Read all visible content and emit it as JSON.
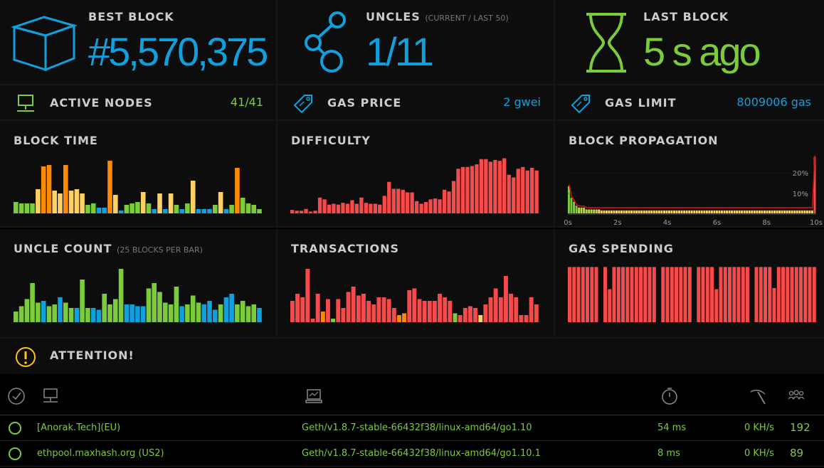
{
  "stats": {
    "best_block": {
      "label": "BEST BLOCK",
      "value": "#5,570,375",
      "icon": "cube-icon",
      "color": "#10a0de"
    },
    "uncles": {
      "label": "UNCLES",
      "sublabel": "(CURRENT / LAST 50)",
      "value": "1/11",
      "icon": "uncles-icon",
      "color": "#10a0de"
    },
    "last_block": {
      "label": "LAST BLOCK",
      "value": "5 s ago",
      "icon": "hourglass-icon",
      "color": "#7bcc3a"
    }
  },
  "mid": {
    "active_nodes": {
      "label": "ACTIVE NODES",
      "value": "41/41",
      "icon": "node-icon"
    },
    "gas_price": {
      "label": "GAS PRICE",
      "value": "2 gwei",
      "icon": "price-tag-icon"
    },
    "gas_limit": {
      "label": "GAS LIMIT",
      "value": "8009006 gas",
      "icon": "price-tag-icon"
    }
  },
  "colors": {
    "green": "#7bcc3a",
    "blue": "#10a0de",
    "orange": "#ff8a00",
    "yellow": "#ffd162",
    "red": "#f74b4b"
  },
  "charts": {
    "block_time": {
      "title": "BLOCK TIME"
    },
    "difficulty": {
      "title": "DIFFICULTY"
    },
    "block_propagation": {
      "title": "BLOCK PROPAGATION"
    },
    "uncle_count": {
      "title": "UNCLE COUNT",
      "sublabel": "(25 BLOCKS PER BAR)"
    },
    "transactions": {
      "title": "TRANSACTIONS"
    },
    "gas_spending": {
      "title": "GAS SPENDING"
    }
  },
  "chart_data": [
    {
      "type": "bar",
      "title": "BLOCK TIME",
      "values": [
        8,
        7,
        7,
        7,
        17,
        33,
        34,
        16,
        14,
        34,
        16,
        17,
        14,
        6,
        7,
        4,
        4,
        37,
        13,
        2,
        6,
        7,
        8,
        15,
        7,
        3,
        14,
        3,
        14,
        6,
        3,
        7,
        23,
        3,
        3,
        3,
        6,
        15,
        3,
        6,
        32,
        11,
        7,
        6,
        3
      ],
      "colors": [
        "g",
        "g",
        "g",
        "g",
        "y",
        "o",
        "o",
        "y",
        "y",
        "o",
        "y",
        "y",
        "y",
        "g",
        "g",
        "b",
        "b",
        "o",
        "y",
        "b",
        "g",
        "g",
        "g",
        "y",
        "g",
        "b",
        "y",
        "b",
        "y",
        "g",
        "b",
        "g",
        "y",
        "b",
        "b",
        "b",
        "g",
        "y",
        "b",
        "g",
        "o",
        "g",
        "g",
        "g",
        "g"
      ]
    },
    {
      "type": "bar",
      "title": "DIFFICULTY",
      "values": [
        4,
        3,
        3,
        5,
        2,
        3,
        18,
        16,
        10,
        11,
        10,
        12,
        11,
        15,
        11,
        18,
        12,
        11,
        11,
        10,
        20,
        36,
        28,
        28,
        27,
        24,
        24,
        14,
        11,
        13,
        16,
        17,
        16,
        27,
        25,
        37,
        51,
        53,
        53,
        54,
        56,
        62,
        62,
        59,
        61,
        60,
        63,
        44,
        41,
        51,
        53,
        49,
        52,
        49
      ],
      "colors": "r"
    },
    {
      "type": "area",
      "title": "BLOCK PROPAGATION",
      "x_ticks": [
        "0s",
        "2s",
        "4s",
        "6s",
        "8s",
        "10s"
      ],
      "y_ticks": [
        "10%",
        "20%"
      ],
      "bins": [
        14,
        8,
        6,
        4,
        3,
        3,
        3,
        2,
        2,
        2,
        2,
        2,
        2,
        1.5,
        1.5,
        1.5,
        1.5,
        1.5,
        1.5,
        1.5,
        1.5,
        1.5,
        1.5,
        1.5,
        1.5,
        1.5,
        1.5,
        1.5,
        1.5,
        1.5,
        1.5,
        1.5,
        1.5,
        1.5,
        1.5,
        1.5,
        1.5,
        1.5,
        1.5,
        1.5,
        1.5,
        1.5,
        1.5,
        1.5,
        1.5,
        1.5,
        1.5,
        1.5,
        1.5,
        1.5,
        1.5,
        1.5,
        1.5,
        1.5,
        1.5,
        1.5,
        1.5,
        1.5,
        1.5,
        1.5,
        1.5,
        1.5,
        1.5,
        1.5,
        1.5,
        1.5,
        1.5,
        1.5,
        1.5,
        1.5,
        1.5,
        1.5,
        1.5,
        1.5,
        1.5,
        1.5,
        1.5,
        1.5,
        1.5,
        1.5,
        1.5,
        1.5,
        1.5,
        1.5,
        1.5,
        1.5,
        1.5,
        1.5,
        1.5,
        1.5,
        1.5,
        1.5,
        1.5,
        1.5,
        1.5,
        1.5,
        1.5,
        1.5,
        29
      ]
    },
    {
      "type": "bar",
      "title": "UNCLE COUNT",
      "values": [
        6,
        9,
        13,
        22,
        11,
        12,
        9,
        10,
        14,
        11,
        8,
        8,
        24,
        8,
        8,
        7,
        16,
        10,
        13,
        30,
        10,
        10,
        9,
        9,
        19,
        22,
        17,
        11,
        10,
        20,
        9,
        10,
        15,
        11,
        10,
        12,
        7,
        10,
        14,
        16,
        10,
        12,
        9,
        10,
        8
      ],
      "colors": [
        "g",
        "g",
        "g",
        "g",
        "g",
        "b",
        "g",
        "g",
        "b",
        "g",
        "g",
        "b",
        "g",
        "g",
        "b",
        "b",
        "g",
        "g",
        "g",
        "g",
        "b",
        "b",
        "b",
        "b",
        "g",
        "g",
        "g",
        "g",
        "g",
        "g",
        "b",
        "g",
        "g",
        "g",
        "b",
        "b",
        "b",
        "g",
        "b",
        "b",
        "g",
        "g",
        "g",
        "g",
        "b"
      ]
    },
    {
      "type": "bar",
      "title": "TRANSACTIONS",
      "values": [
        12,
        16,
        14,
        30,
        2,
        16,
        6,
        13,
        2,
        13,
        8,
        17,
        20,
        15,
        16,
        12,
        10,
        14,
        14,
        13,
        8,
        4,
        5,
        18,
        19,
        13,
        12,
        12,
        12,
        16,
        14,
        12,
        5,
        4,
        8,
        9,
        8,
        4,
        10,
        14,
        19,
        14,
        26,
        16,
        14,
        4,
        4,
        14,
        10
      ],
      "colors": [
        "r",
        "r",
        "r",
        "r",
        "r",
        "r",
        "o",
        "r",
        "g",
        "r",
        "r",
        "r",
        "r",
        "r",
        "r",
        "r",
        "r",
        "r",
        "r",
        "r",
        "r",
        "o",
        "o",
        "r",
        "r",
        "r",
        "r",
        "r",
        "r",
        "r",
        "r",
        "r",
        "g",
        "r",
        "r",
        "r",
        "r",
        "y",
        "r",
        "r",
        "r",
        "r",
        "r",
        "r",
        "r",
        "r",
        "r",
        "r",
        "r"
      ]
    },
    {
      "type": "bar",
      "title": "GAS SPENDING",
      "values": [
        97,
        97,
        97,
        97,
        97,
        97,
        97,
        97,
        58,
        97,
        97,
        97,
        97,
        97,
        97,
        97,
        97,
        97,
        97,
        97,
        97,
        97,
        97,
        97,
        97,
        97,
        97,
        97,
        97,
        97,
        58,
        97,
        97,
        97,
        97,
        97,
        97,
        97,
        97,
        97,
        97,
        97,
        60,
        97,
        97,
        97,
        97,
        97,
        97,
        97,
        97,
        97
      ],
      "gaps": [
        7,
        20,
        28,
        41
      ],
      "colors": "r"
    }
  ],
  "attention": {
    "label": "ATTENTION!",
    "icon": "alert-icon"
  },
  "table": {
    "header_icons": [
      "check-circle-icon",
      "node-icon",
      "laptop-icon",
      "timer-icon",
      "pickaxe-icon",
      "peers-icon"
    ],
    "rows": [
      {
        "name": "[Anorak.Tech](EU)",
        "client": "Geth/v1.8.7-stable-66432f38/linux-amd64/go1.10",
        "latency": "54 ms",
        "hashrate": "0 KH/s",
        "peers": "192"
      },
      {
        "name": "ethpool.maxhash.org (US2)",
        "client": "Geth/v1.8.7-stable-66432f38/linux-amd64/go1.10.1",
        "latency": "8 ms",
        "hashrate": "0 KH/s",
        "peers": "89"
      }
    ]
  }
}
